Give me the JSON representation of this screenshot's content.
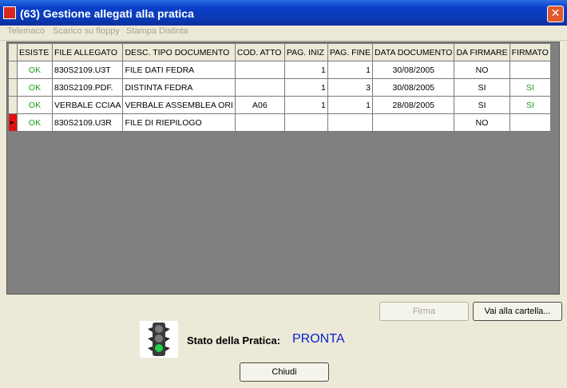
{
  "window": {
    "title": "(63) Gestione allegati alla pratica",
    "close_label": "✕"
  },
  "menu": {
    "items": [
      "Telemaco",
      "Scarico su floppy",
      "Stampa Distinta"
    ]
  },
  "table": {
    "columns": [
      "ESISTE",
      "FILE ALLEGATO",
      "DESC. TIPO DOCUMENTO",
      "COD. ATTO",
      "PAG. INIZ",
      "PAG. FINE",
      "DATA DOCUMENTO",
      "DA FIRMARE",
      "FIRMATO"
    ],
    "rows": [
      {
        "indicator": "",
        "esiste": "OK",
        "file": "830S2109.U3T",
        "desc": "FILE DATI FEDRA",
        "cod": "",
        "pag_iniz": "1",
        "pag_fine": "1",
        "data": "30/08/2005",
        "da_firmare": "NO",
        "firmato": ""
      },
      {
        "indicator": "",
        "esiste": "OK",
        "file": "830S2109.PDF.",
        "desc": "DISTINTA FEDRA",
        "cod": "",
        "pag_iniz": "1",
        "pag_fine": "3",
        "data": "30/08/2005",
        "da_firmare": "SI",
        "firmato": "SI"
      },
      {
        "indicator": "",
        "esiste": "OK",
        "file": "VERBALE CCIAA",
        "desc": "VERBALE ASSEMBLEA ORI",
        "cod": "A06",
        "pag_iniz": "1",
        "pag_fine": "1",
        "data": "28/08/2005",
        "da_firmare": "SI",
        "firmato": "SI"
      },
      {
        "indicator": "▸",
        "esiste": "OK",
        "file": "830S2109.U3R",
        "desc": "FILE DI RIEPILOGO",
        "cod": "",
        "pag_iniz": "",
        "pag_fine": "",
        "data": "",
        "da_firmare": "NO",
        "firmato": ""
      }
    ]
  },
  "buttons": {
    "firma": "Firma",
    "vai_cartella": "Vai alla cartella...",
    "chiudi": "Chiudi"
  },
  "status": {
    "label": "Stato della Pratica:",
    "value": "PRONTA",
    "traffic_light_icon": "traffic-light-green-icon"
  },
  "colors": {
    "status_value": "#0a1fd0",
    "ok_green": "#16a016",
    "current_row_marker": "#e01010"
  }
}
